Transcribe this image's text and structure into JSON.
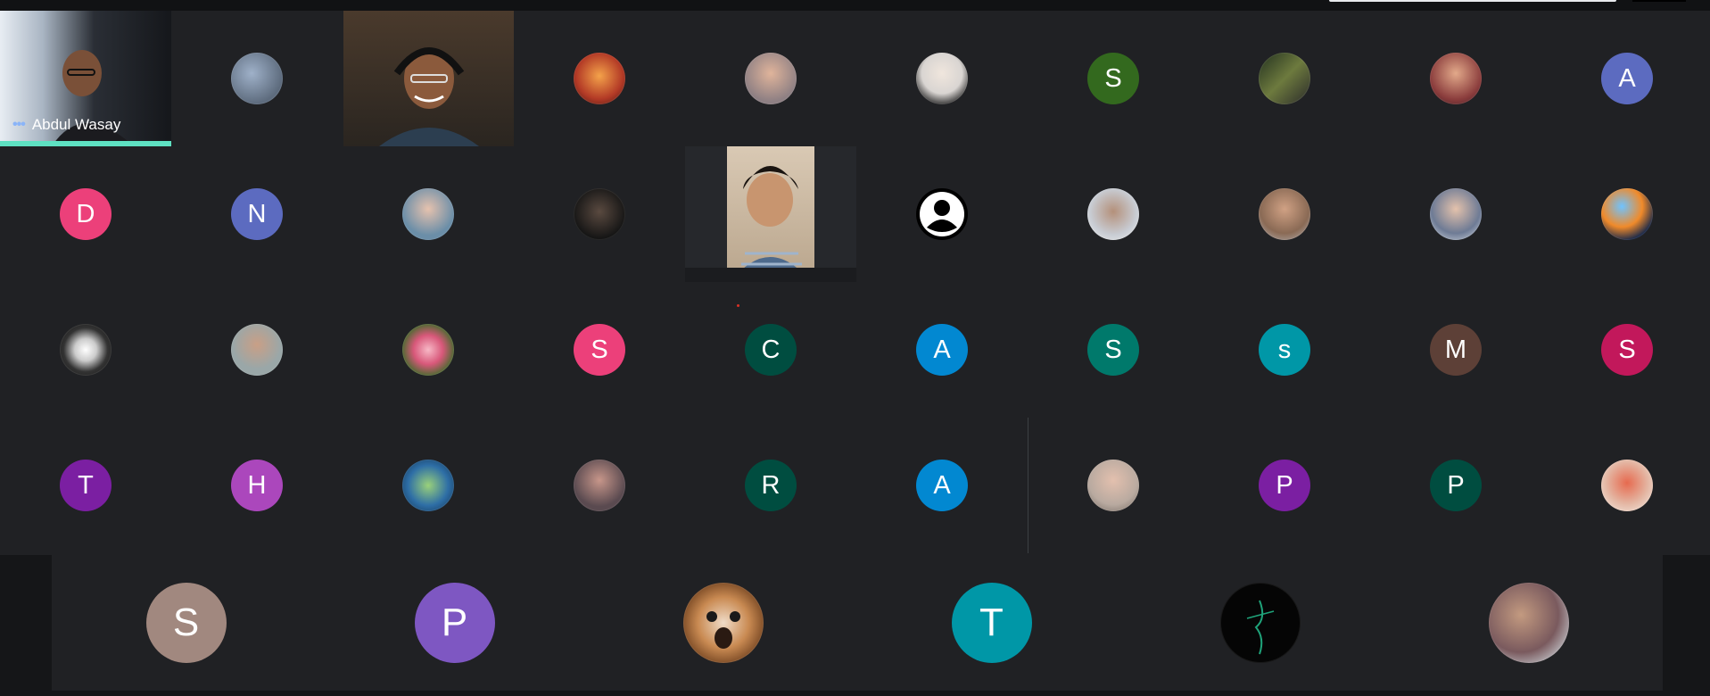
{
  "meeting": {
    "pinned_participant": "Abdul Wasay",
    "more_options_icon": "more-options-icon"
  },
  "participants": {
    "p1": {
      "type": "video",
      "name": "Abdul Wasay"
    },
    "p2": {
      "type": "photo",
      "color": "#5d6b7d"
    },
    "p3": {
      "type": "video",
      "color": "#3a3026"
    },
    "p4": {
      "type": "photo",
      "color": "#b33a26"
    },
    "p5": {
      "type": "photo",
      "color": "#8d7f83"
    },
    "p6": {
      "type": "photo",
      "color": "#d9d5d2"
    },
    "p7": {
      "type": "initial",
      "initial": "S",
      "color": "#33691e"
    },
    "p8": {
      "type": "photo",
      "color": "#3c4a3a"
    },
    "p9": {
      "type": "photo",
      "color": "#8a3c3c"
    },
    "p10": {
      "type": "initial",
      "initial": "A",
      "color": "#5c6bc0"
    },
    "p11": {
      "type": "initial",
      "initial": "D",
      "color": "#ec407a"
    },
    "p12": {
      "type": "initial",
      "initial": "N",
      "color": "#5c6bc0"
    },
    "p13": {
      "type": "photo",
      "color": "#6b8ea8"
    },
    "p14": {
      "type": "photo",
      "color": "#2a2a2a"
    },
    "p15": {
      "type": "video",
      "color": "#8b7a66"
    },
    "p16": {
      "type": "default-avatar"
    },
    "p17": {
      "type": "photo",
      "color": "#c8ccd3"
    },
    "p18": {
      "type": "photo",
      "color": "#8a6a55"
    },
    "p19": {
      "type": "photo",
      "color": "#6e7b95"
    },
    "p20": {
      "type": "photo",
      "color": "#1c2a4a"
    },
    "p21": {
      "type": "photo",
      "color": "#cccccc"
    },
    "p22": {
      "type": "photo",
      "color": "#9aa7a8"
    },
    "p23": {
      "type": "photo",
      "color": "#d8587a"
    },
    "p24": {
      "type": "initial",
      "initial": "S",
      "color": "#ec407a"
    },
    "p25": {
      "type": "initial",
      "initial": "C",
      "color": "#004d40"
    },
    "p26": {
      "type": "initial",
      "initial": "A",
      "color": "#0288d1"
    },
    "p27": {
      "type": "initial",
      "initial": "S",
      "color": "#00796b"
    },
    "p28": {
      "type": "initial",
      "initial": "s",
      "color": "#0097a7"
    },
    "p29": {
      "type": "initial",
      "initial": "M",
      "color": "#5d4037"
    },
    "p30": {
      "type": "initial",
      "initial": "S",
      "color": "#c2185b"
    },
    "p31": {
      "type": "initial",
      "initial": "T",
      "color": "#7b1fa2"
    },
    "p32": {
      "type": "initial",
      "initial": "H",
      "color": "#ab47bc"
    },
    "p33": {
      "type": "photo",
      "color": "#2e6ea6"
    },
    "p34": {
      "type": "photo",
      "color": "#5a4a50"
    },
    "p35": {
      "type": "initial",
      "initial": "R",
      "color": "#004d40"
    },
    "p36": {
      "type": "initial",
      "initial": "A",
      "color": "#0288d1"
    },
    "p37": {
      "type": "photo",
      "color": "#b9aaa0"
    },
    "p38": {
      "type": "initial",
      "initial": "P",
      "color": "#7b1fa2"
    },
    "p39": {
      "type": "initial",
      "initial": "P",
      "color": "#004d40"
    },
    "p40": {
      "type": "photo",
      "color": "#e4b7a4"
    }
  },
  "bottom_row": {
    "b1": {
      "type": "initial",
      "initial": "S",
      "color": "#a1887f"
    },
    "b2": {
      "type": "initial",
      "initial": "P",
      "color": "#7e57c2"
    },
    "b3": {
      "type": "photo",
      "color": "#c98a52"
    },
    "b4": {
      "type": "initial",
      "initial": "T",
      "color": "#0097a7"
    },
    "b5": {
      "type": "photo",
      "color": "#050505"
    },
    "b6": {
      "type": "photo",
      "color": "#7a5a5e"
    }
  }
}
